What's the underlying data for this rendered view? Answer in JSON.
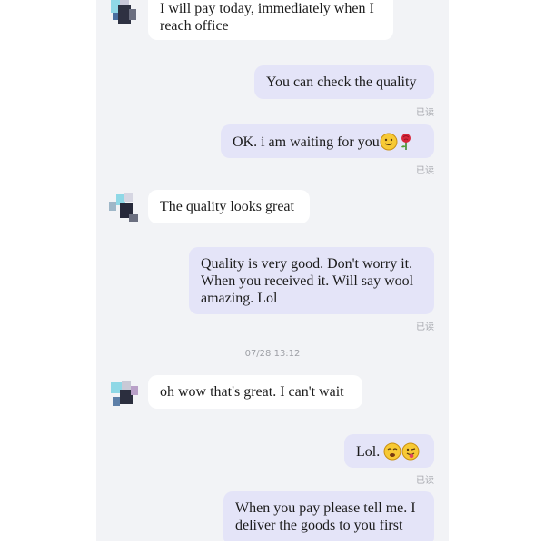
{
  "messages": [
    {
      "side": "in",
      "text_lines": [
        "I will pay today, immediately when I",
        "reach office"
      ]
    },
    {
      "side": "out",
      "text": "You can check the quality",
      "status": "已读"
    },
    {
      "side": "out",
      "text": "OK. i am waiting for you",
      "emoji": [
        "smiley-icon",
        "rose-icon"
      ],
      "status": "已读"
    },
    {
      "side": "in",
      "text": "The quality looks great"
    },
    {
      "side": "out",
      "text_lines": [
        "Quality is very good. Don't worry it.",
        "When you received it. Will say wool",
        "amazing. Lol"
      ],
      "status": "已读"
    },
    {
      "side": "time",
      "text": "07/28 13:12"
    },
    {
      "side": "in",
      "text": "oh wow that's great. I can't wait"
    },
    {
      "side": "out",
      "text": "Lol.",
      "emoji": [
        "blushing-smiley-icon",
        "winking-tongue-icon"
      ],
      "status": "已读"
    },
    {
      "side": "out",
      "text_lines": [
        "When you pay please tell me. I",
        "deliver the goods to you first"
      ]
    }
  ],
  "colors": {
    "background": "#f2f3f6",
    "incoming_bubble": "#ffffff",
    "outgoing_bubble": "#e4e4f8",
    "read_receipt": "#a5a7ad"
  }
}
